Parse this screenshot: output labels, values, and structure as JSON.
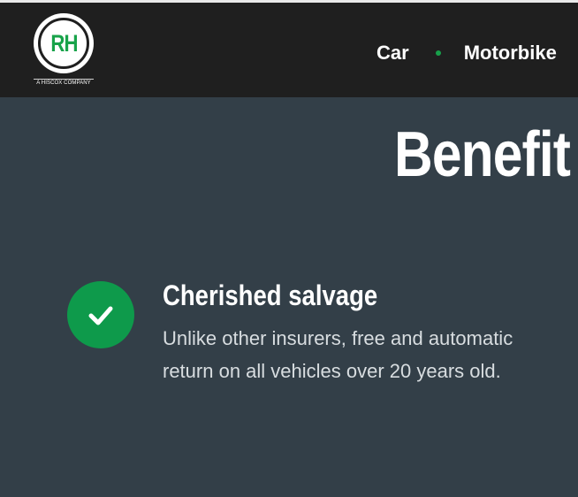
{
  "header": {
    "logo": {
      "letters": "RH",
      "tagline": "A HISCOX COMPANY"
    },
    "nav": [
      {
        "label": "Car"
      },
      {
        "label": "Motorbike"
      }
    ]
  },
  "main": {
    "heading": "Benefit",
    "benefit": {
      "title": "Cherished salvage",
      "description": "Unlike other insurers, free and automatic return on all vehicles over 20 years old."
    }
  },
  "colors": {
    "header_bg": "#1f1f1f",
    "page_bg": "#333f48",
    "accent_green": "#0e9a4b"
  },
  "icons": {
    "check": "checkmark-icon",
    "nav_separator": "dot-separator-icon"
  }
}
